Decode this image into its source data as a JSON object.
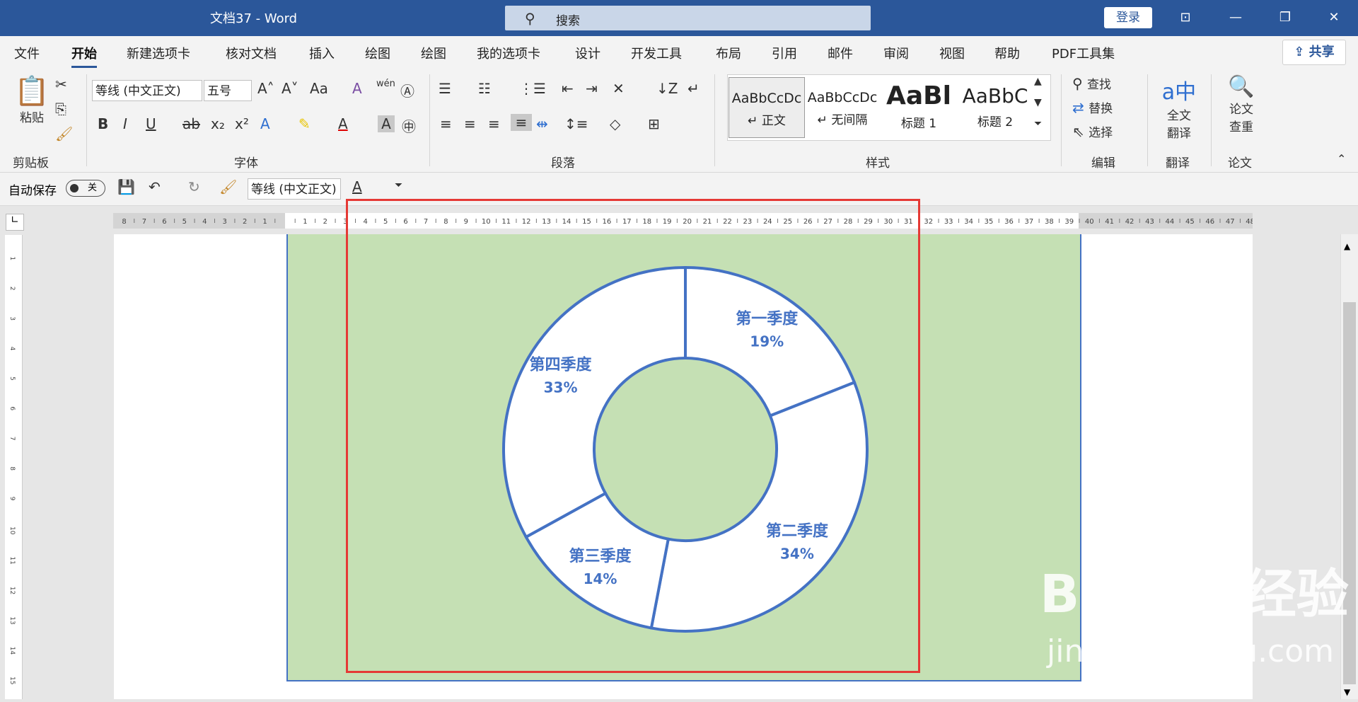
{
  "titlebar": {
    "title": "文档37  -  Word",
    "search_placeholder": "搜索",
    "login_label": "登录"
  },
  "tabs": [
    {
      "label": "文件"
    },
    {
      "label": "开始"
    },
    {
      "label": "新建选项卡"
    },
    {
      "label": "核对文档"
    },
    {
      "label": "插入"
    },
    {
      "label": "绘图"
    },
    {
      "label": "绘图"
    },
    {
      "label": "我的选项卡"
    },
    {
      "label": "设计"
    },
    {
      "label": "开发工具"
    },
    {
      "label": "布局"
    },
    {
      "label": "引用"
    },
    {
      "label": "邮件"
    },
    {
      "label": "审阅"
    },
    {
      "label": "视图"
    },
    {
      "label": "帮助"
    },
    {
      "label": "PDF工具集"
    }
  ],
  "share_label": "共享",
  "ribbon": {
    "clipboard": {
      "paste": "粘贴",
      "group": "剪贴板"
    },
    "font": {
      "name": "等线 (中文正文)",
      "size": "五号",
      "group": "字体"
    },
    "paragraph": {
      "group": "段落"
    },
    "styles": {
      "group": "样式",
      "cards": [
        {
          "sample": "AaBbCcDc",
          "name": "↵ 正文"
        },
        {
          "sample": "AaBbCcDc",
          "name": "↵ 无间隔"
        },
        {
          "sample": "AaBl",
          "name": "标题 1"
        },
        {
          "sample": "AaBbC",
          "name": "标题 2"
        }
      ]
    },
    "edit": {
      "find": "查找",
      "replace": "替换",
      "select": "选择",
      "group": "编辑"
    },
    "translate": {
      "label1": "全文",
      "label2": "翻译",
      "group": "翻译"
    },
    "paper": {
      "label1": "论文",
      "label2": "查重",
      "group": "论文"
    }
  },
  "qat": {
    "autosave": "自动保存",
    "toggle": "关",
    "font_name": "等线 (中文正文)"
  },
  "colors": {
    "accent": "#2b579a",
    "chart_bg": "#c5e0b4",
    "chart_line": "#4472c4",
    "label": "#4472c4",
    "red_box": "#e53935"
  },
  "chart_data": {
    "type": "pie",
    "donut": true,
    "categories": [
      "第一季度",
      "第二季度",
      "第三季度",
      "第四季度"
    ],
    "values": [
      19,
      34,
      14,
      33
    ],
    "labels": [
      "19%",
      "34%",
      "14%",
      "33%"
    ]
  },
  "watermark": {
    "line1": "Bai du 经验",
    "line2": "jingyan.baidu.com"
  }
}
